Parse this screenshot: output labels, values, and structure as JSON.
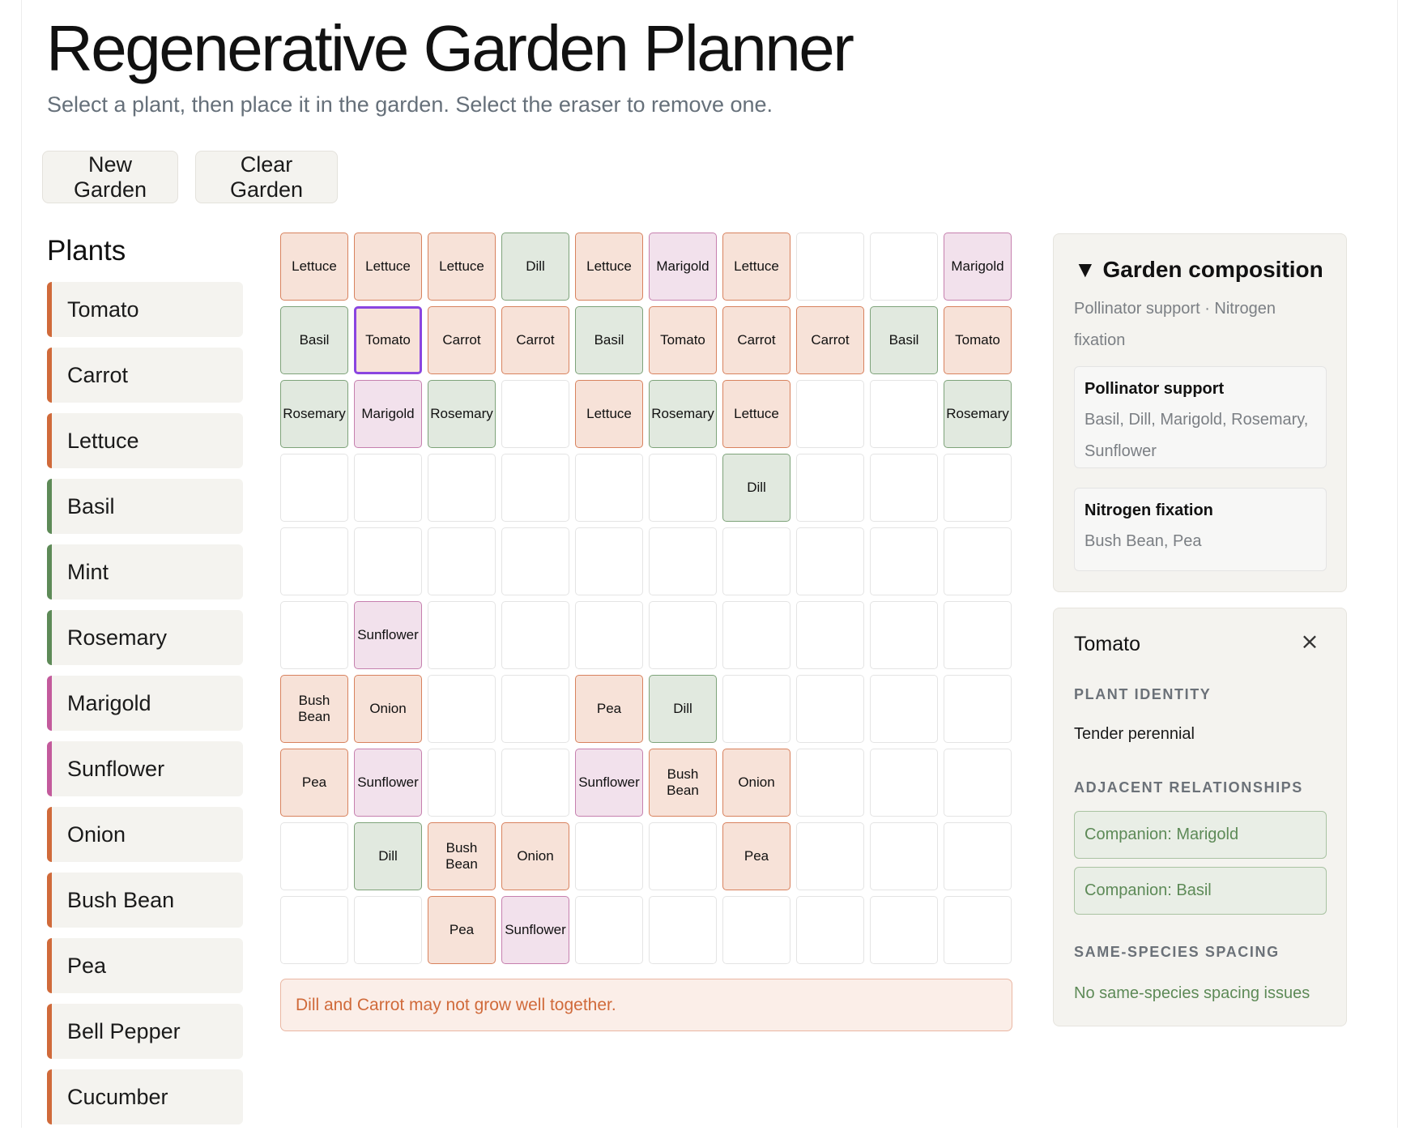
{
  "header": {
    "title": "Regenerative Garden Planner",
    "subtitle": "Select a plant, then place it in the garden. Select the eraser to remove one."
  },
  "toolbar": {
    "new_garden_label": "New Garden",
    "clear_garden_label": "Clear Garden"
  },
  "plants": {
    "title": "Plants",
    "items": [
      {
        "label": "Tomato",
        "color_group": "warm"
      },
      {
        "label": "Carrot",
        "color_group": "warm"
      },
      {
        "label": "Lettuce",
        "color_group": "warm"
      },
      {
        "label": "Basil",
        "color_group": "herb"
      },
      {
        "label": "Mint",
        "color_group": "herb"
      },
      {
        "label": "Rosemary",
        "color_group": "herb"
      },
      {
        "label": "Marigold",
        "color_group": "flower"
      },
      {
        "label": "Sunflower",
        "color_group": "flower"
      },
      {
        "label": "Onion",
        "color_group": "warm"
      },
      {
        "label": "Bush Bean",
        "color_group": "warm"
      },
      {
        "label": "Pea",
        "color_group": "warm"
      },
      {
        "label": "Bell Pepper",
        "color_group": "warm"
      },
      {
        "label": "Cucumber",
        "color_group": "warm"
      }
    ]
  },
  "colors": {
    "warm": "#d06a3a",
    "herb": "#5d8a57",
    "flower": "#c35a9c",
    "selected_outline": "#8a45e0"
  },
  "garden": {
    "selected_cell": [
      1,
      1
    ],
    "rows": [
      [
        "Lettuce",
        "Lettuce",
        "Lettuce",
        "Dill",
        "Lettuce",
        "Marigold",
        "Lettuce",
        "",
        "",
        "Marigold"
      ],
      [
        "Basil",
        "Tomato",
        "Carrot",
        "Carrot",
        "Basil",
        "Tomato",
        "Carrot",
        "Carrot",
        "Basil",
        "Tomato"
      ],
      [
        "Rosemary",
        "Marigold",
        "Rosemary",
        "",
        "Lettuce",
        "Rosemary",
        "Lettuce",
        "",
        "",
        "Rosemary"
      ],
      [
        "",
        "",
        "",
        "",
        "",
        "",
        "Dill",
        "",
        "",
        ""
      ],
      [
        "",
        "",
        "",
        "",
        "",
        "",
        "",
        "",
        "",
        ""
      ],
      [
        "",
        "Sunflower",
        "",
        "",
        "",
        "",
        "",
        "",
        "",
        ""
      ],
      [
        "Bush Bean",
        "Onion",
        "",
        "",
        "Pea",
        "Dill",
        "",
        "",
        "",
        ""
      ],
      [
        "Pea",
        "Sunflower",
        "",
        "",
        "Sunflower",
        "Bush Bean",
        "Onion",
        "",
        "",
        ""
      ],
      [
        "",
        "Dill",
        "Bush Bean",
        "Onion",
        "",
        "",
        "Pea",
        "",
        "",
        ""
      ],
      [
        "",
        "",
        "Pea",
        "Sunflower",
        "",
        "",
        "",
        "",
        "",
        ""
      ]
    ],
    "plant_groups": {
      "Lettuce": "warm",
      "Tomato": "warm",
      "Carrot": "warm",
      "Onion": "warm",
      "Bush Bean": "warm",
      "Pea": "warm",
      "Dill": "herb",
      "Basil": "herb",
      "Rosemary": "herb",
      "Marigold": "flower",
      "Sunflower": "flower"
    }
  },
  "warning": {
    "text": "Dill and Carrot may not grow well together."
  },
  "composition": {
    "title": "Garden composition",
    "toggle_icon": "▼",
    "summary": "Pollinator support · Nitrogen fixation",
    "cards": [
      {
        "heading": "Pollinator support",
        "value": "Basil, Dill, Marigold, Rosemary, Sunflower"
      },
      {
        "heading": "Nitrogen fixation",
        "value": "Bush Bean, Pea"
      }
    ]
  },
  "detail": {
    "name": "Tomato",
    "close_icon": "×",
    "identity_label": "PLANT IDENTITY",
    "identity_value": "Tender perennial",
    "relationships_label": "ADJACENT RELATIONSHIPS",
    "relationships": [
      "Companion: Marigold",
      "Companion: Basil"
    ],
    "spacing_label": "SAME-SPECIES SPACING",
    "spacing_value": "No same-species spacing issues"
  }
}
